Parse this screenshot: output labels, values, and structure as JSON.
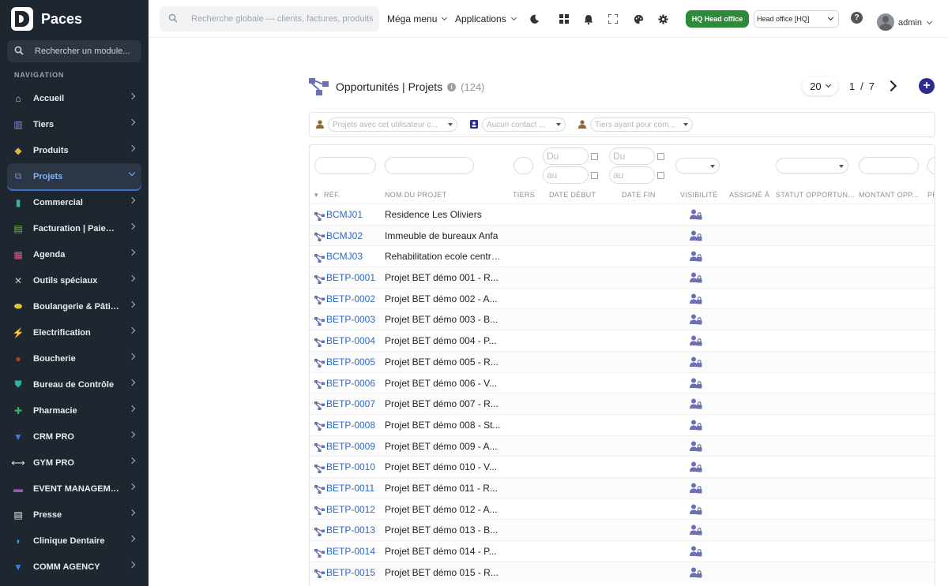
{
  "brand": {
    "name": "Paces"
  },
  "sidebar": {
    "search_placeholder": "Rechercher un module...",
    "nav_title": "NAVIGATION",
    "items": [
      {
        "label": "Accueil",
        "icon": "home-icon",
        "color": "#c9ccd1",
        "glyph": "⌂"
      },
      {
        "label": "Tiers",
        "icon": "building-icon",
        "color": "#8b8fd6",
        "glyph": "▥"
      },
      {
        "label": "Produits",
        "icon": "box-icon",
        "color": "#e0b24a",
        "glyph": "◆"
      },
      {
        "label": "Projets",
        "icon": "project-icon",
        "color": "#8d7fd8",
        "glyph": "⧉",
        "active": true
      },
      {
        "label": "Commercial",
        "icon": "briefcase-icon",
        "color": "#37b3a4",
        "glyph": "▮"
      },
      {
        "label": "Facturation | Paiement",
        "icon": "invoice-icon",
        "color": "#78b84a",
        "glyph": "▤"
      },
      {
        "label": "Agenda",
        "icon": "calendar-icon",
        "color": "#d5608a",
        "glyph": "▦"
      },
      {
        "label": "Outils spéciaux",
        "icon": "tools-icon",
        "color": "#c9ccd1",
        "glyph": "✕"
      },
      {
        "label": "Boulangerie & Pâtisserie",
        "icon": "bread-icon",
        "color": "#e0c33a",
        "glyph": "⬬"
      },
      {
        "label": "Electrification",
        "icon": "lightning-icon",
        "color": "#f2c230",
        "glyph": "⚡"
      },
      {
        "label": "Boucherie",
        "icon": "meat-icon",
        "color": "#c0392b",
        "glyph": "●"
      },
      {
        "label": "Bureau de Contrôle",
        "icon": "shield-icon",
        "color": "#2bb3a4",
        "glyph": "⛊"
      },
      {
        "label": "Pharmacie",
        "icon": "cross-icon",
        "color": "#34b36a",
        "glyph": "✚"
      },
      {
        "label": "CRM PRO",
        "icon": "funnel-icon",
        "color": "#3a7fe0",
        "glyph": "▼"
      },
      {
        "label": "GYM PRO",
        "icon": "dumbbell-icon",
        "color": "#e8eaee",
        "glyph": "⟷"
      },
      {
        "label": "EVENT MANAGEMENT",
        "icon": "ticket-icon",
        "color": "#9b59b6",
        "glyph": "▬"
      },
      {
        "label": "Presse",
        "icon": "newspaper-icon",
        "color": "#e8eaee",
        "glyph": "▤"
      },
      {
        "label": "Clinique Dentaire",
        "icon": "tooth-icon",
        "color": "#3a9fe0",
        "glyph": "◗"
      },
      {
        "label": "COMM AGENCY",
        "icon": "megaphone-icon",
        "color": "#3a7fe0",
        "glyph": "▼"
      }
    ]
  },
  "topbar": {
    "search_placeholder": "Recherche globale — clients, factures, produits...",
    "mega_menu": "Méga menu",
    "applications": "Applications",
    "hq_badge": "HQ Head office",
    "entity": "Head office [HQ]",
    "user": "admin"
  },
  "page": {
    "title": "Opportunités | Projets",
    "count": "(124)",
    "per_page": "20",
    "page_current": "1",
    "page_sep": "/",
    "page_total": "7",
    "add_symbol": "+"
  },
  "filters": {
    "user_placeholder": "Projets avec cet utilisateur c...",
    "contact_placeholder": "Aucun contact ...",
    "tiers_placeholder": "Tiers ayant pour com..."
  },
  "table": {
    "date_from": "Du",
    "date_to": "au",
    "columns": [
      "RÉF.",
      "NOM DU PROJET",
      "TIERS",
      "DATE DÉBUT",
      "DATE FIN",
      "VISIBILITÉ",
      "ASSIGNÉ À",
      "STATUT OPPORTUN...",
      "MONTANT OPP...",
      "PR"
    ],
    "rows": [
      {
        "ref": "BCMJ01",
        "name": "Residence Les Oliviers"
      },
      {
        "ref": "BCMJ02",
        "name": "Immeuble de bureaux Anfa"
      },
      {
        "ref": "BCMJ03",
        "name": "Rehabilitation ecole centrale"
      },
      {
        "ref": "BETP-0001",
        "name": "Projet BET démo 001 - R..."
      },
      {
        "ref": "BETP-0002",
        "name": "Projet BET démo 002 - A..."
      },
      {
        "ref": "BETP-0003",
        "name": "Projet BET démo 003 - B..."
      },
      {
        "ref": "BETP-0004",
        "name": "Projet BET démo 004 - P..."
      },
      {
        "ref": "BETP-0005",
        "name": "Projet BET démo 005 - R..."
      },
      {
        "ref": "BETP-0006",
        "name": "Projet BET démo 006 - V..."
      },
      {
        "ref": "BETP-0007",
        "name": "Projet BET démo 007 - R..."
      },
      {
        "ref": "BETP-0008",
        "name": "Projet BET démo 008 - St..."
      },
      {
        "ref": "BETP-0009",
        "name": "Projet BET démo 009 - A..."
      },
      {
        "ref": "BETP-0010",
        "name": "Projet BET démo 010 - V..."
      },
      {
        "ref": "BETP-0011",
        "name": "Projet BET démo 011 - R..."
      },
      {
        "ref": "BETP-0012",
        "name": "Projet BET démo 012 - A..."
      },
      {
        "ref": "BETP-0013",
        "name": "Projet BET démo 013 - B..."
      },
      {
        "ref": "BETP-0014",
        "name": "Projet BET démo 014 - P..."
      },
      {
        "ref": "BETP-0015",
        "name": "Projet BET démo 015 - R..."
      }
    ]
  },
  "colors": {
    "sidebar_bg": "#1e2630",
    "link": "#2f69c7",
    "hq_green": "#2c8a3a",
    "project_icon": "#6b6fb3"
  }
}
